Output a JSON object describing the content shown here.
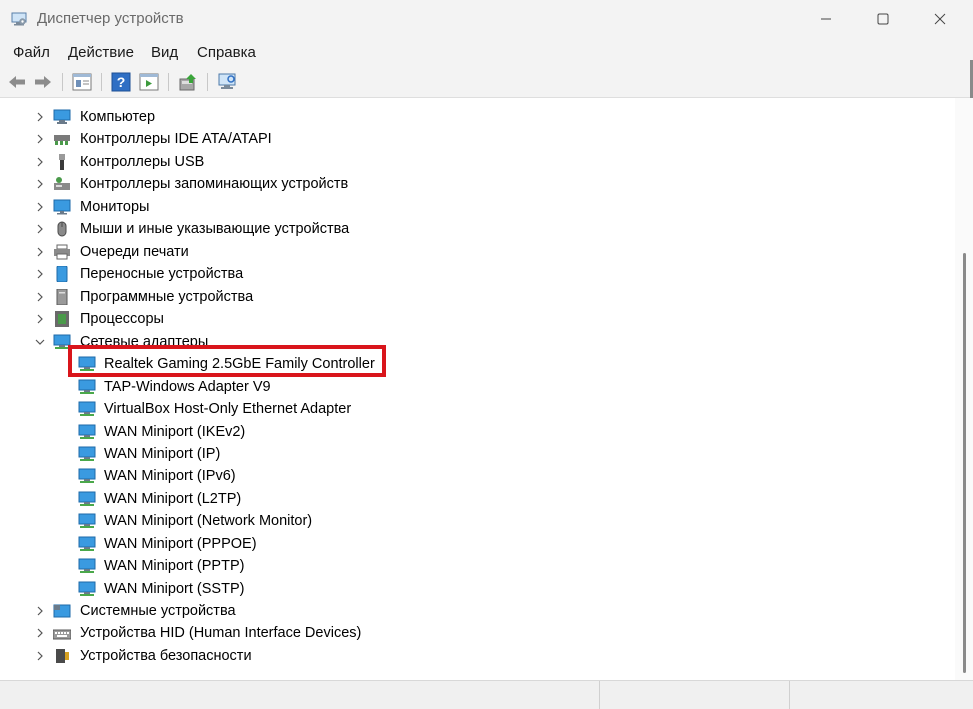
{
  "window": {
    "title": "Диспетчер устройств"
  },
  "menu": [
    "Файл",
    "Действие",
    "Вид",
    "Справка"
  ],
  "toolbar": {
    "icons": [
      "back-arrow-icon",
      "forward-arrow-icon",
      "properties-icon",
      "help-icon",
      "view-details-icon",
      "update-driver-icon",
      "scan-hardware-icon"
    ]
  },
  "tree": {
    "categories": [
      {
        "label": "Компьютер",
        "icon": "computer-icon",
        "expanded": false
      },
      {
        "label": "Контроллеры IDE ATA/ATAPI",
        "icon": "ide-controller-icon",
        "expanded": false
      },
      {
        "label": "Контроллеры USB",
        "icon": "usb-icon",
        "expanded": false
      },
      {
        "label": "Контроллеры запоминающих устройств",
        "icon": "storage-controller-icon",
        "expanded": false
      },
      {
        "label": "Мониторы",
        "icon": "monitor-icon",
        "expanded": false
      },
      {
        "label": "Мыши и иные указывающие устройства",
        "icon": "mouse-icon",
        "expanded": false
      },
      {
        "label": "Очереди печати",
        "icon": "printer-icon",
        "expanded": false
      },
      {
        "label": "Переносные устройства",
        "icon": "portable-device-icon",
        "expanded": false
      },
      {
        "label": "Программные устройства",
        "icon": "software-device-icon",
        "expanded": false
      },
      {
        "label": "Процессоры",
        "icon": "processor-icon",
        "expanded": false
      },
      {
        "label": "Сетевые адаптеры",
        "icon": "network-adapter-icon",
        "expanded": true
      }
    ],
    "network_adapters": [
      "Realtek Gaming 2.5GbE Family Controller",
      "TAP-Windows Adapter V9",
      "VirtualBox Host-Only Ethernet Adapter",
      "WAN Miniport (IKEv2)",
      "WAN Miniport (IP)",
      "WAN Miniport (IPv6)",
      "WAN Miniport (L2TP)",
      "WAN Miniport (Network Monitor)",
      "WAN Miniport (PPPOE)",
      "WAN Miniport (PPTP)",
      "WAN Miniport (SSTP)"
    ],
    "categories_after": [
      {
        "label": "Системные устройства",
        "icon": "system-device-icon",
        "expanded": false
      },
      {
        "label": "Устройства HID (Human Interface Devices)",
        "icon": "hid-keyboard-icon",
        "expanded": false
      },
      {
        "label": "Устройства безопасности",
        "icon": "security-device-icon",
        "expanded": false
      }
    ]
  },
  "colors": {
    "highlight": "#d9151b",
    "window_chrome": "#f3f3f3",
    "network_icon": "#2a8fd6"
  }
}
